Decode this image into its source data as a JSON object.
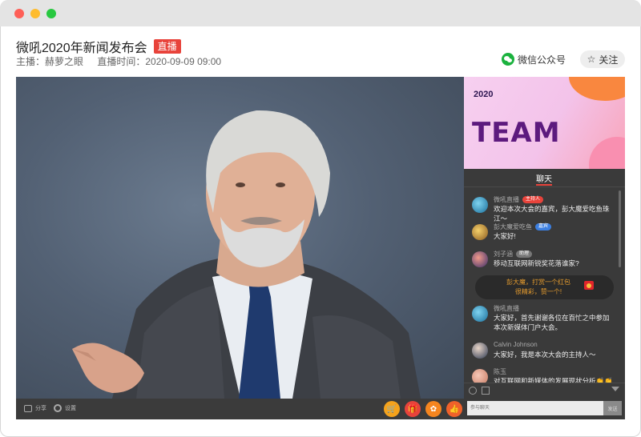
{
  "header": {
    "title": "微吼2020年新闻发布会",
    "live_badge": "直播",
    "host": "主播：赫萝之眼",
    "time": "直播时间：2020-09-09 09:00",
    "wechat_label": "微信公众号",
    "follow_label": "关注"
  },
  "player": {
    "share_label": "分享",
    "settings_label": "设置",
    "actions": [
      {
        "name": "cart-icon",
        "color": "#f5a31c"
      },
      {
        "name": "gift-icon",
        "color": "#e8433b"
      },
      {
        "name": "film-icon",
        "color": "#f5851f"
      },
      {
        "name": "like-icon",
        "color": "#f0612a"
      }
    ]
  },
  "sidebar": {
    "banner_year": "2020",
    "banner_title": "TEAM",
    "chat_tab": "聊天",
    "messages": [
      {
        "name": "微吼直播",
        "tag": "主持人",
        "tag_color": "#e8433b",
        "text": "欢迎本次大会的嘉宾，彭大魔爱吃鱼珠江～"
      },
      {
        "name": "彭大魔爱吃鱼",
        "tag": "嘉宾",
        "tag_color": "#3c7fe0",
        "text": "大家好!"
      },
      {
        "name": "刘子涵",
        "tag": "助理",
        "tag_color": "#777777",
        "text": "移动互联网新锐奖花落谁家?"
      },
      {
        "name": "微吼直播",
        "tag": "",
        "tag_color": "",
        "text": "大家好，首先谢谢各位在百忙之中参加本次新媒体门户大会。"
      },
      {
        "name": "Calvin Johnson",
        "tag": "",
        "tag_color": "",
        "text": "大家好，我是本次大会的主持人～"
      },
      {
        "name": "陈玉",
        "tag": "",
        "tag_color": "",
        "text": "对互联网和新媒体的发展现状分析👏👏"
      }
    ],
    "red_packet_text": "彭大魔，打赏一个红包\n很精彩，赞一个!",
    "input_placeholder": "参与聊天",
    "send_label": "发送"
  }
}
